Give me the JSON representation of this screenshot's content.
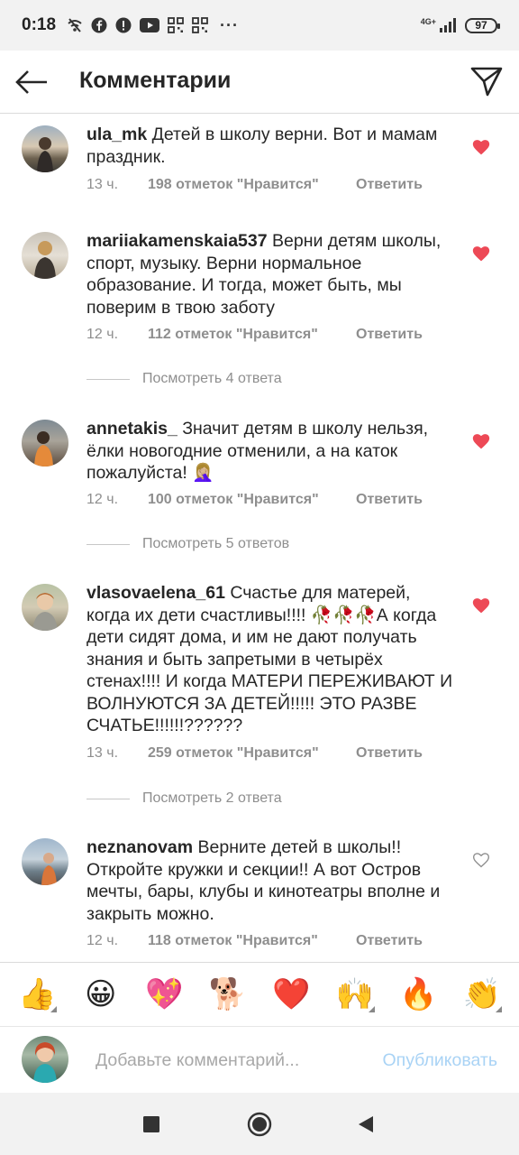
{
  "status_bar": {
    "time": "0:18",
    "icons": [
      "wifi-off-icon",
      "facebook-icon",
      "alert-icon",
      "youtube-icon",
      "grid-icon",
      "grid-icon",
      "more-dots-icon",
      "signal-4g-icon",
      "battery-icon"
    ],
    "more": "···",
    "network": "4G+",
    "battery": "97"
  },
  "header": {
    "title": "Комментарии",
    "back_icon": "arrow-left-icon",
    "send_icon": "paper-plane-icon"
  },
  "comments": [
    {
      "username": "ula_mk",
      "text": "Детей в школу верни. Вот и мамам праздник.",
      "time": "13 ч.",
      "likes": "198 отметок \"Нравится\"",
      "reply": "Ответить",
      "liked": true
    },
    {
      "username": "mariiakamenskaia537",
      "text": "Верни детям школы, спорт, музыку. Верни нормальное образование. И тогда, может быть, мы поверим в твою заботу",
      "time": "12 ч.",
      "likes": "112 отметок \"Нравится\"",
      "reply": "Ответить",
      "liked": true,
      "view_replies": "Посмотреть 4 ответа"
    },
    {
      "username": "annetakis_",
      "text": "Значит детям в школу нельзя, ёлки новогодние отменили, а на каток пожалуйста! 🤦🏼‍♀️",
      "time": "12 ч.",
      "likes": "100 отметок \"Нравится\"",
      "reply": "Ответить",
      "liked": true,
      "view_replies": "Посмотреть 5 ответов"
    },
    {
      "username": "vlasovaelena_61",
      "text": "Счастье для матерей, когда их дети счастливы!!!! 🥀🥀🥀А когда дети сидят дома, и им не дают получать знания и быть запретыми в четырёх стенах!!!! И когда МАТЕРИ ПЕРЕЖИВАЮТ И ВОЛНУЮТСЯ ЗА ДЕТЕЙ!!!!! ЭТО РАЗВЕ СЧАТЬЕ!!!!!!??????",
      "time": "13 ч.",
      "likes": "259 отметок \"Нравится\"",
      "reply": "Ответить",
      "liked": true,
      "view_replies": "Посмотреть 2 ответа"
    },
    {
      "username": "neznanovam",
      "text": "Верните детей в школы!! Откройте кружки и секции!! А вот Остров мечты, бары, клубы и кинотеатры вполне и закрыть можно.",
      "time": "12 ч.",
      "likes": "118 отметок \"Нравится\"",
      "reply": "Ответить",
      "liked": false
    }
  ],
  "emoji_bar": [
    "👍",
    "😀",
    "💖",
    "🐕",
    "❤️",
    "🙌",
    "🔥",
    "👏"
  ],
  "composer": {
    "placeholder": "Добавьте комментарий...",
    "publish": "Опубликовать"
  },
  "nav": {
    "icons": [
      "recents-square-icon",
      "home-circle-icon",
      "back-triangle-icon"
    ]
  },
  "colors": {
    "heart_red": "#ed4956",
    "meta_gray": "#8e8e8e",
    "publish_blue_disabled": "#a9d3f5"
  }
}
